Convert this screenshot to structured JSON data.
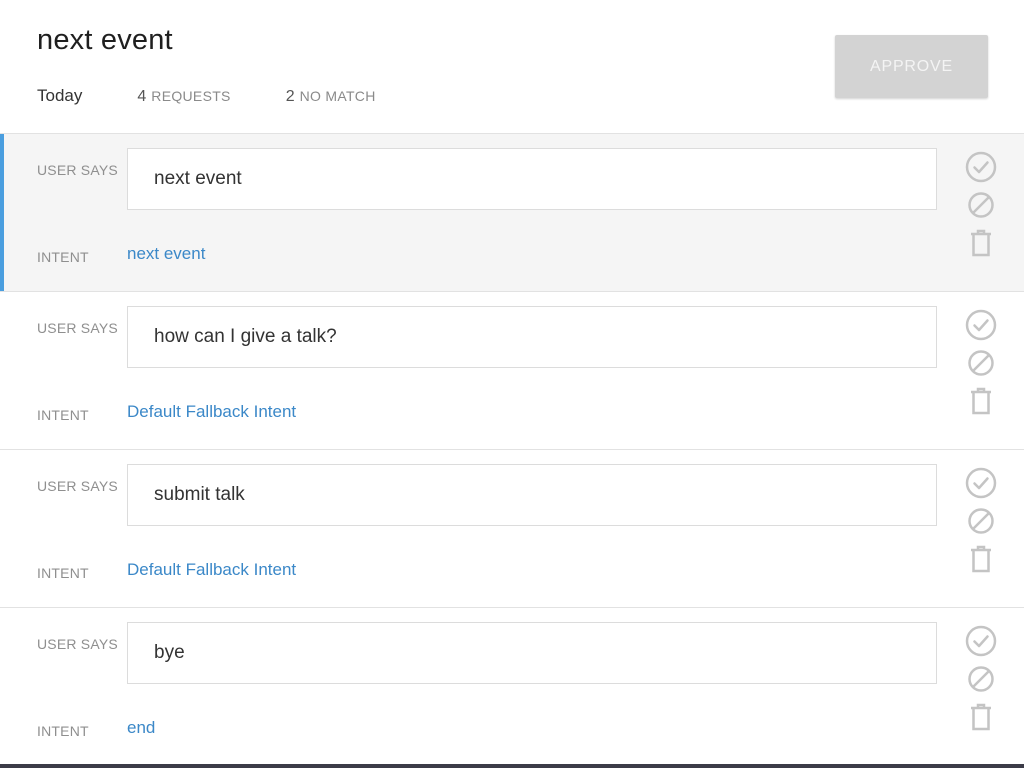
{
  "header": {
    "title": "next event",
    "today_label": "Today",
    "requests_count": "4",
    "requests_label": "REQUESTS",
    "no_match_count": "2",
    "no_match_label": "NO MATCH",
    "approve_label": "APPROVE"
  },
  "labels": {
    "user_says": "USER SAYS",
    "intent": "INTENT"
  },
  "rows": [
    {
      "user_says": "next event",
      "intent": "next event",
      "selected": true
    },
    {
      "user_says": "how can I give a talk?",
      "intent": "Default Fallback Intent",
      "selected": false
    },
    {
      "user_says": "submit talk",
      "intent": "Default Fallback Intent",
      "selected": false
    },
    {
      "user_says": "bye",
      "intent": "end",
      "selected": false
    }
  ],
  "row_actions": [
    "check-circle-icon",
    "block-icon",
    "trash-icon"
  ],
  "colors": {
    "accent": "#4a9edf",
    "link": "#3b88c8",
    "approve_disabled": "#d3d3d3",
    "icon": "#c4c4c4"
  }
}
